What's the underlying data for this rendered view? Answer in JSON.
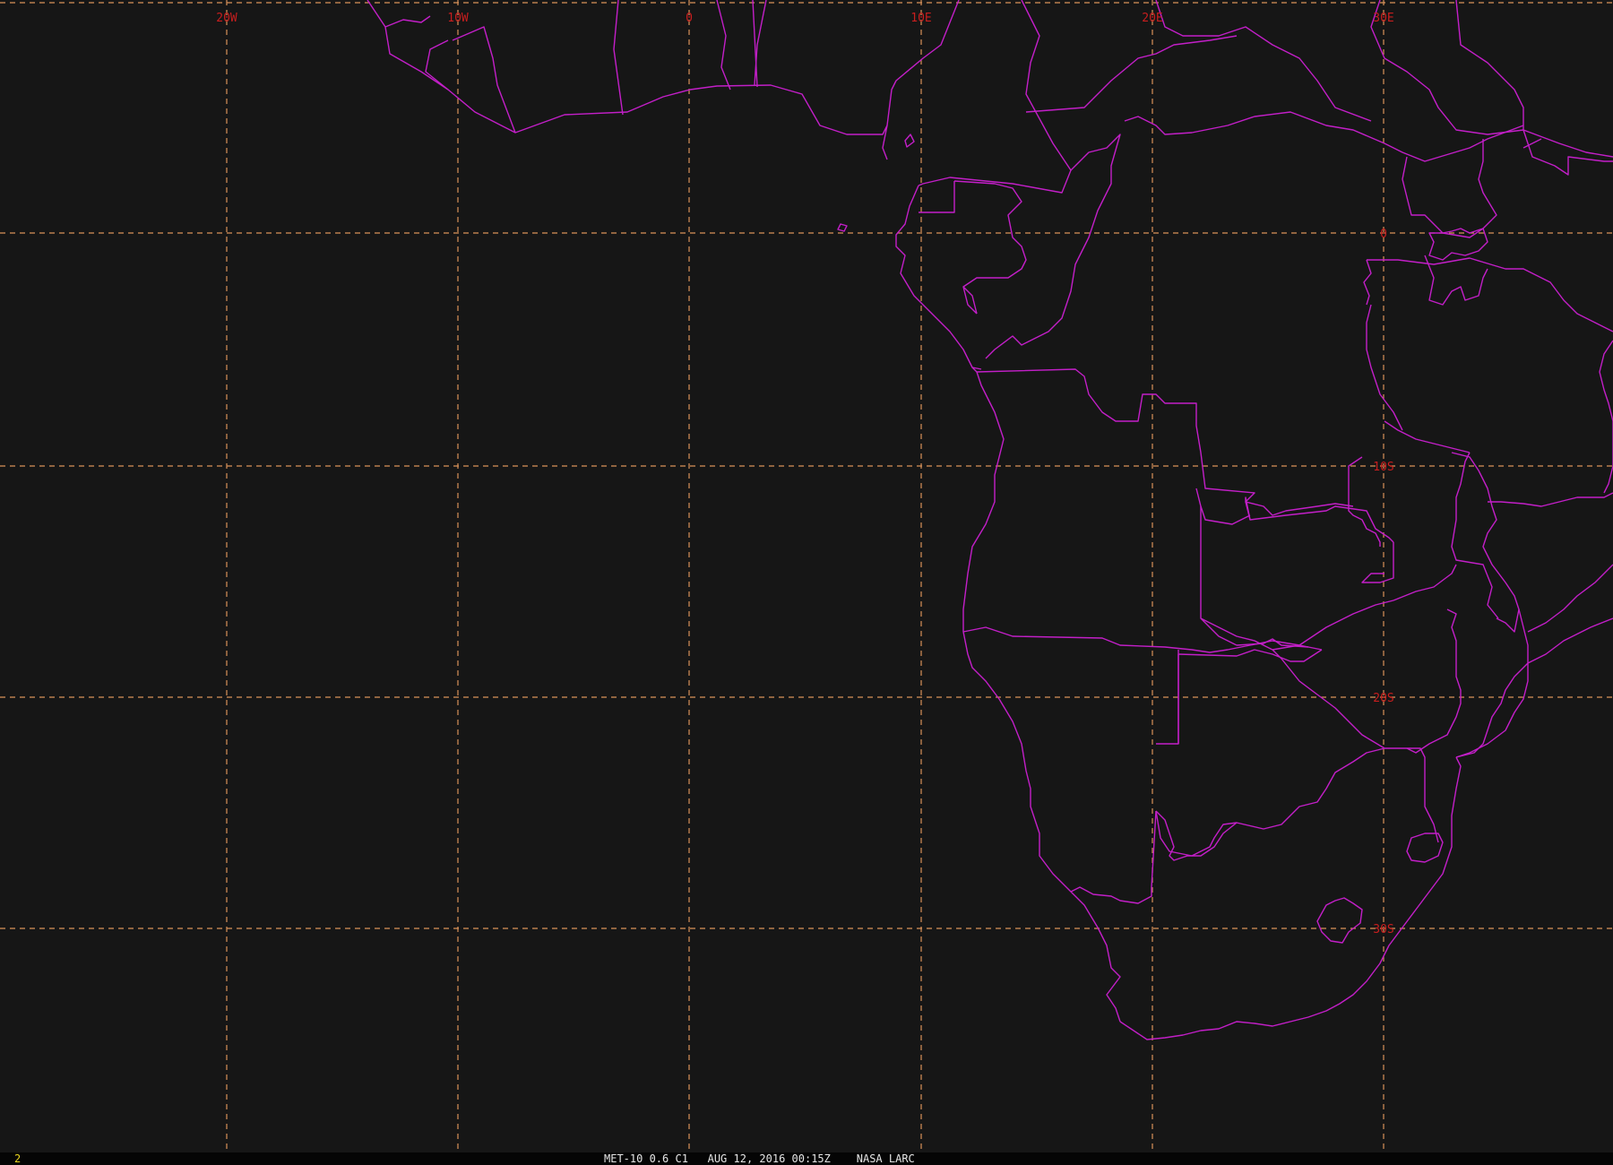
{
  "colors": {
    "background": "#161616",
    "grid": "#d9925a",
    "grid_label": "#c81e1e",
    "boundary": "#c31fc8",
    "status_text": "#e6e6e6",
    "frame_text": "#e6d21e"
  },
  "grid_labels": {
    "lon": [
      "20W",
      "10W",
      "0",
      "10E",
      "20E",
      "30E"
    ],
    "lat": [
      "0",
      "10S",
      "20S",
      "30S"
    ]
  },
  "status": {
    "frame": "2",
    "caption": "MET-10 0.6 C1   AUG 12, 2016 00:15Z    NASA LARC"
  }
}
